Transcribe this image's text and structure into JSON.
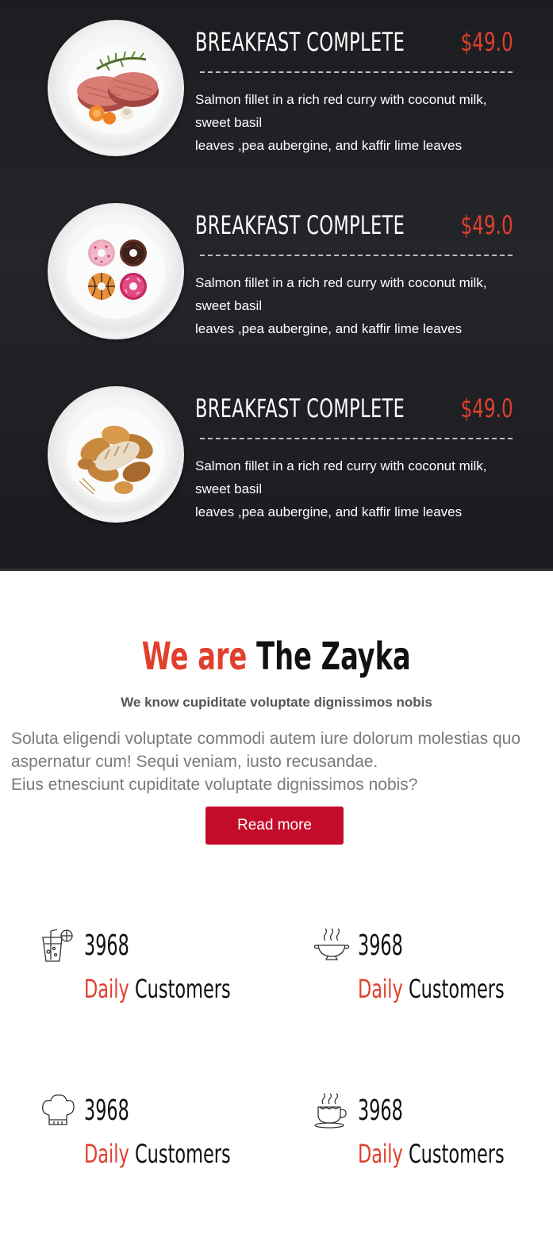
{
  "menu": {
    "items": [
      {
        "title": "BREAKFAST COMPLETE",
        "price": "$49.0",
        "desc_line1": "Salmon fillet in a rich red curry with coconut milk, sweet basil",
        "desc_line2": "leaves ,pea aubergine, and kaffir lime leaves",
        "image": "grilled-meat-plate"
      },
      {
        "title": "BREAKFAST COMPLETE",
        "price": "$49.0",
        "desc_line1": "Salmon fillet in a rich red curry with coconut milk, sweet basil",
        "desc_line2": "leaves ,pea aubergine, and kaffir lime leaves",
        "image": "donuts-plate"
      },
      {
        "title": "BREAKFAST COMPLETE",
        "price": "$49.0",
        "desc_line1": "Salmon fillet in a rich red curry with coconut milk, sweet basil",
        "desc_line2": "leaves ,pea aubergine, and kaffir lime leaves",
        "image": "bread-plate"
      }
    ]
  },
  "about": {
    "title_accent": "We are",
    "title_main": "The Zayka",
    "subtitle": "We know cupiditate voluptate dignissimos nobis",
    "text_line1": "Soluta eligendi voluptate commodi autem iure dolorum molestias quo aspernatur cum! Sequi veniam, iusto recusandae.",
    "text_line2": "Eius etnesciunt cupiditate voluptate dignissimos nobis?",
    "button_label": "Read more"
  },
  "counters": [
    {
      "number": "3968",
      "label_accent": "Daily",
      "label_main": "Customers",
      "icon": "drink-glass-icon"
    },
    {
      "number": "3968",
      "label_accent": "Daily",
      "label_main": "Customers",
      "icon": "hot-bowl-icon"
    },
    {
      "number": "3968",
      "label_accent": "Daily",
      "label_main": "Customers",
      "icon": "chef-hat-icon"
    },
    {
      "number": "3968",
      "label_accent": "Daily",
      "label_main": "Customers",
      "icon": "coffee-cup-icon"
    }
  ],
  "colors": {
    "accent": "#e0402c",
    "button": "#c40c2a",
    "menu_background": "#1f2024"
  }
}
